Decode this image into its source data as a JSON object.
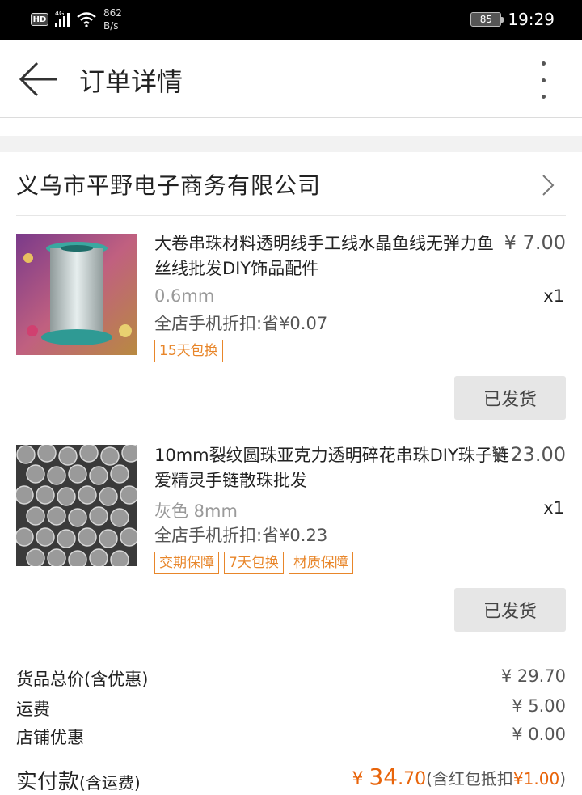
{
  "status_bar": {
    "hd": "HD",
    "network": "4G",
    "speed_value": "862",
    "speed_unit": "B/s",
    "battery": "85",
    "time": "19:29"
  },
  "appbar": {
    "title": "订单详情"
  },
  "shop": {
    "name": "义乌市平野电子商务有限公司"
  },
  "items": [
    {
      "name": "大卷串珠材料透明线手工线水晶鱼线无弹力鱼丝线批发DIY饰品配件",
      "price": "¥ 7.00",
      "spec": "0.6mm",
      "qty": "x1",
      "discount": "全店手机折扣:省¥0.07",
      "tags": [
        "15天包换"
      ],
      "status": "已发货"
    },
    {
      "name": "10mm裂纹圆珠亚克力透明碎花串珠DIY珠子链爱精灵手链散珠批发",
      "price": "¥ 23.00",
      "spec": "灰色 8mm",
      "qty": "x1",
      "discount": "全店手机折扣:省¥0.23",
      "tags": [
        "交期保障",
        "7天包换",
        "材质保障"
      ],
      "status": "已发货"
    }
  ],
  "summary": {
    "goods_total_label": "货品总价(含优惠)",
    "goods_total_value": "¥ 29.70",
    "shipping_label": "运费",
    "shipping_value": "¥ 5.00",
    "shop_discount_label": "店铺优惠",
    "shop_discount_value": "¥ 0.00",
    "paid_label": "实付款",
    "paid_label_suffix": "(含运费)",
    "paid_currency": "¥ ",
    "paid_int": "34",
    "paid_dec": ".70",
    "paid_note_prefix": "(含红包抵扣",
    "paid_note_amount": "¥1.00",
    "paid_note_suffix": ")"
  },
  "colors": {
    "accent": "#e8862a",
    "price_highlight": "#e8640a",
    "status_bar": "#000000"
  }
}
